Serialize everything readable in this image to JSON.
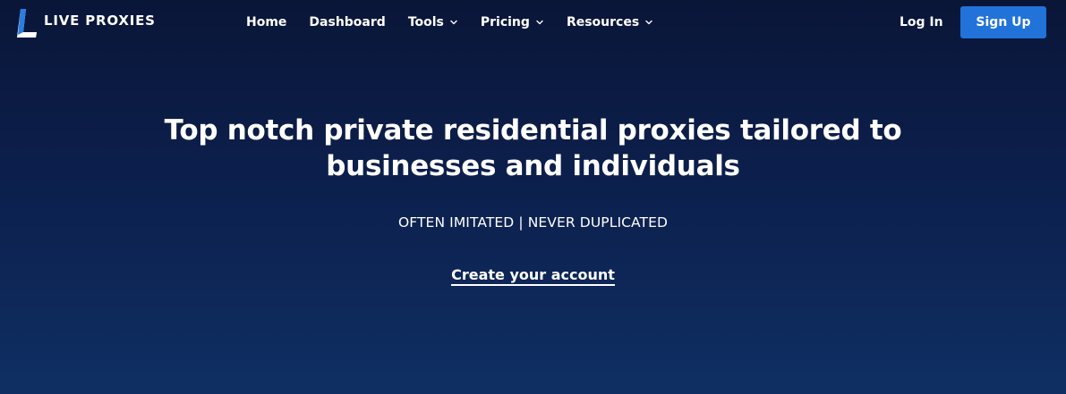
{
  "brand": {
    "name": "LIVE PROXIES",
    "logo_icon": "live-proxies-logo-icon",
    "accent_color": "#2172d9"
  },
  "nav": {
    "items": [
      {
        "label": "Home",
        "has_dropdown": false
      },
      {
        "label": "Dashboard",
        "has_dropdown": false
      },
      {
        "label": "Tools",
        "has_dropdown": true
      },
      {
        "label": "Pricing",
        "has_dropdown": true
      },
      {
        "label": "Resources",
        "has_dropdown": true
      }
    ],
    "login_label": "Log In",
    "signup_label": "Sign Up"
  },
  "hero": {
    "title_line1": "Top notch private residential proxies tailored to",
    "title_line2": "businesses and individuals",
    "tagline": "OFTEN IMITATED | NEVER DUPLICATED",
    "cta_label": "Create your account"
  },
  "colors": {
    "background_top": "#0a1638",
    "background_bottom": "#0f2f63",
    "signup_button": "#2172d9",
    "text": "#ffffff"
  }
}
